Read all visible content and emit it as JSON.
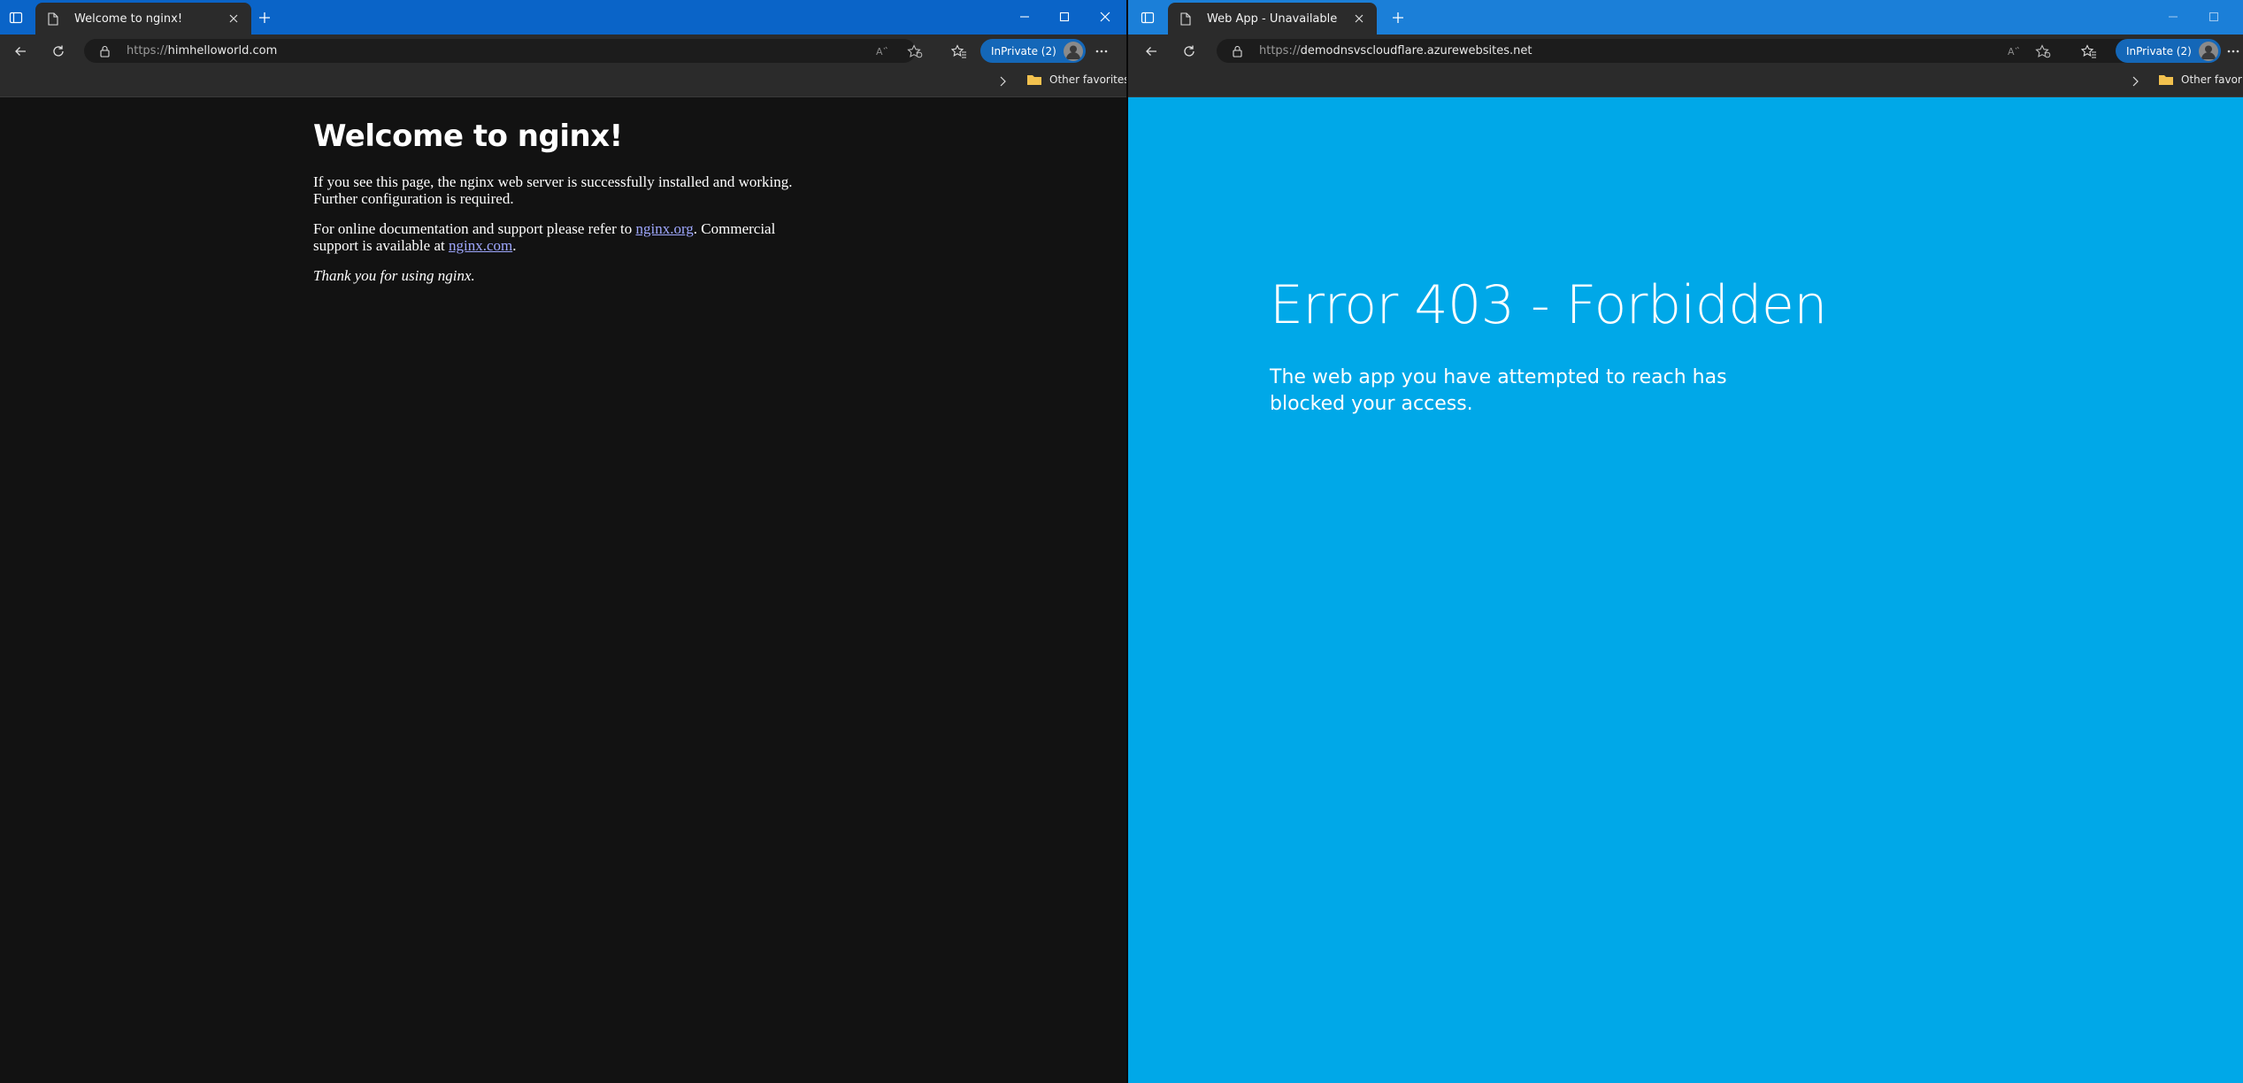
{
  "left_window": {
    "tab": {
      "title": "Welcome to nginx!"
    },
    "address": {
      "protocol": "https://",
      "host": "himhelloworld.com"
    },
    "inprivate_label": "InPrivate (2)",
    "favorites": {
      "other_label": "Other favorites"
    },
    "page": {
      "heading": "Welcome to nginx!",
      "p1": "If you see this page, the nginx web server is successfully installed and working. Further configuration is required.",
      "p2_prefix": "For online documentation and support please refer to ",
      "p2_link1": "nginx.org",
      "p2_mid": ". Commercial support is available at ",
      "p2_link2": "nginx.com",
      "p2_suffix": ".",
      "p3": "Thank you for using nginx."
    }
  },
  "right_window": {
    "tab": {
      "title": "Web App - Unavailable"
    },
    "address": {
      "protocol": "https://",
      "host": "demodnsvscloudflare.azurewebsites.net"
    },
    "inprivate_label": "InPrivate (2)",
    "favorites": {
      "other_label": "Other favorites"
    },
    "page": {
      "heading": "Error 403 - Forbidden",
      "message": "The web app you have attempted to reach has blocked your access."
    }
  },
  "colors": {
    "left_titlebar": "#0a64c8",
    "right_titlebar": "#1b7fd8",
    "left_page_bg": "#121212",
    "right_page_bg": "#00a8e8",
    "link": "#9fa8ff",
    "inprivate": "#1467b8"
  },
  "icons": [
    "sidebar-toggle-icon",
    "page-icon",
    "close-icon",
    "plus-icon",
    "minimize-icon",
    "maximize-icon",
    "back-icon",
    "refresh-icon",
    "lock-icon",
    "read-aloud-icon",
    "add-favorite-icon",
    "favorites-icon",
    "more-icon",
    "chevron-right-icon",
    "folder-icon",
    "profile-icon"
  ]
}
